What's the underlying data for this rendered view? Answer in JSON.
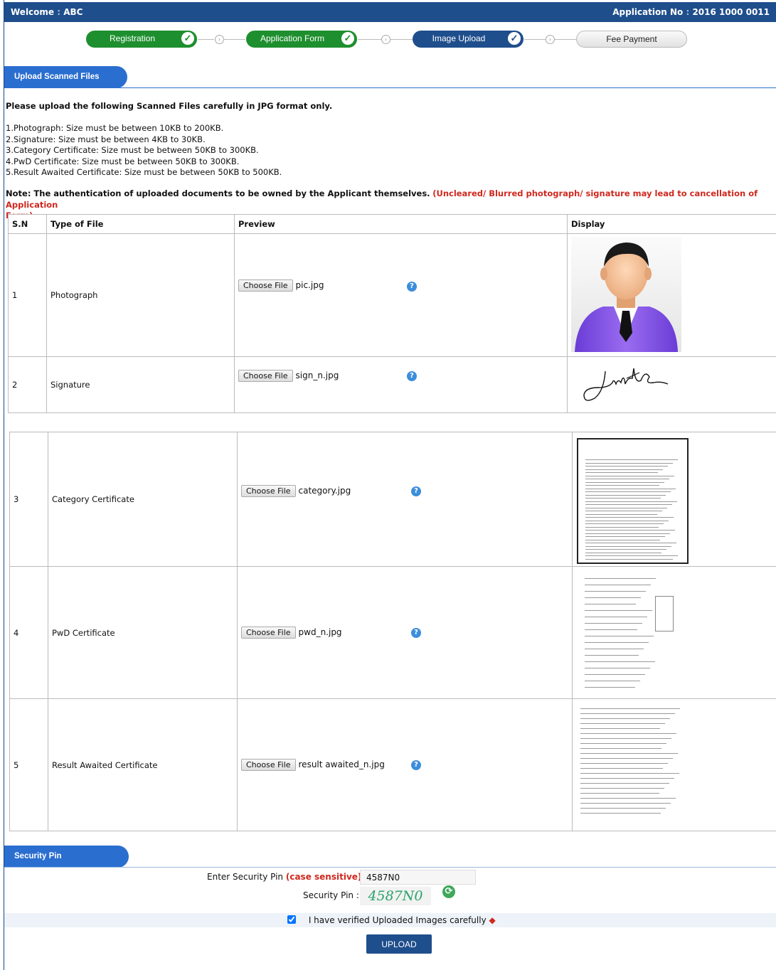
{
  "header": {
    "welcome_label": "Welcome",
    "welcome_sep": ":",
    "user": "ABC",
    "app_no_label": "Application No",
    "app_no_sep": ":",
    "app_no": "2016 1000 0011"
  },
  "steps": [
    {
      "label": "Registration",
      "status": "complete"
    },
    {
      "label": "Application Form",
      "status": "complete"
    },
    {
      "label": "Image Upload",
      "status": "current"
    },
    {
      "label": "Fee Payment",
      "status": "pending"
    }
  ],
  "upload_section": {
    "tab_label": "Upload Scanned Files",
    "intro": "Please upload the following Scanned Files carefully in JPG format only.",
    "rules": [
      "1.Photograph: Size must be between 10KB to 200KB.",
      "2.Signature: Size must be between 4KB to 30KB.",
      "3.Category Certificate: Size must be between 50KB to 300KB.",
      "4.PwD Certificate: Size must be between 50KB to 300KB.",
      "5.Result Awaited Certificate: Size must be between 50KB to 500KB."
    ],
    "note_black": "Note: The authentication of uploaded documents to be owned by the Applicant themselves.",
    "note_red_line1": "(Uncleared/ Blurred photograph/ signature may lead to cancellation of Application",
    "note_red_line2": "Form)"
  },
  "table": {
    "headers": [
      "S.N",
      "Type of File",
      "Preview",
      "Display"
    ],
    "choose_label": "Choose File",
    "rows": [
      {
        "sn": "1",
        "type": "Photograph",
        "file": "pic.jpg"
      },
      {
        "sn": "2",
        "type": "Signature",
        "file": "sign_n.jpg"
      },
      {
        "sn": "3",
        "type": "Category Certificate",
        "file": "category.jpg"
      },
      {
        "sn": "4",
        "type": "PwD Certificate",
        "file": "pwd_n.jpg"
      },
      {
        "sn": "5",
        "type": "Result Awaited Certificate",
        "file": "result awaited_n.jpg"
      }
    ]
  },
  "security": {
    "tab_label": "Security Pin",
    "enter_label": "Enter Security Pin",
    "case_note": "(case sensitive)",
    "colon": ":",
    "pin_value": "4587N0",
    "pin_label": "Security Pin :",
    "captcha_text": "4587N0",
    "verify_label": "I have verified Uploaded Images carefully",
    "verify_checked": true,
    "upload_button": "UPLOAD"
  },
  "colors": {
    "header_blue": "#1f4e8c",
    "step_green": "#1e8f2e",
    "tab_blue": "#2a6ecf",
    "note_red": "#d0281e"
  },
  "icons": [
    "check-icon",
    "arrow-circle-icon",
    "help-icon",
    "refresh-icon",
    "required-marker-icon"
  ]
}
